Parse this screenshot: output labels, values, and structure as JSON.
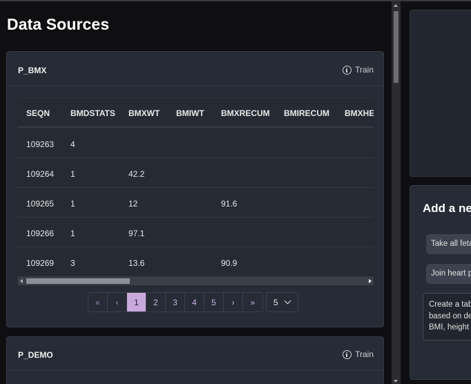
{
  "page": {
    "title": "Data Sources"
  },
  "cards": [
    {
      "name": "P_BMX",
      "train_label": "Train",
      "table": {
        "columns": [
          "SEQN",
          "BMDSTATS",
          "BMXWT",
          "BMIWT",
          "BMXRECUM",
          "BMIRECUM",
          "BMXHEAD"
        ],
        "rows": [
          [
            "109263",
            "4",
            "",
            "",
            "",
            "",
            ""
          ],
          [
            "109264",
            "1",
            "42.2",
            "",
            "",
            "",
            ""
          ],
          [
            "109265",
            "1",
            "12",
            "",
            "91.6",
            "",
            ""
          ],
          [
            "109266",
            "1",
            "97.1",
            "",
            "",
            "",
            ""
          ],
          [
            "109269",
            "3",
            "13.6",
            "",
            "90.9",
            "",
            ""
          ]
        ]
      },
      "pagination": {
        "first": "«",
        "prev": "‹",
        "pages": [
          "1",
          "2",
          "3",
          "4",
          "5"
        ],
        "current": "1",
        "next": "›",
        "last": "»",
        "page_size": "5"
      }
    },
    {
      "name": "P_DEMO",
      "train_label": "Train"
    }
  ],
  "right_panel": {
    "heading": "Add a ne",
    "suggestions": [
      "Take all feta",
      "Join heart p"
    ],
    "prompt_lines": [
      "Create a tab",
      "based on de",
      "BMI, height"
    ]
  },
  "colors": {
    "background": "#101012",
    "card": "#262b35",
    "accent_active_page": "#c9a9dc",
    "page_link": "#c9b2e0"
  }
}
